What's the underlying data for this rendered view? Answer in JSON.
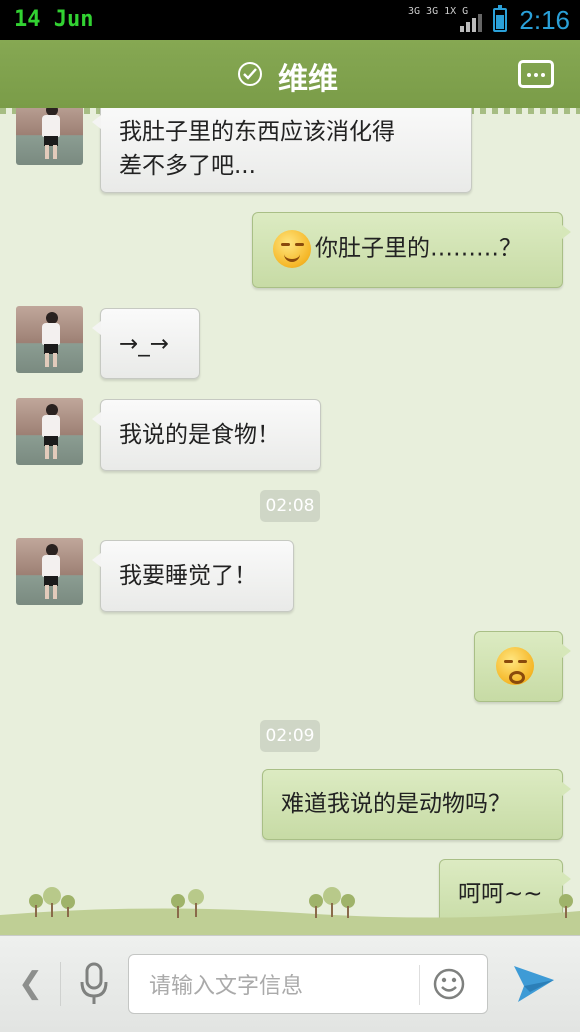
{
  "statusbar": {
    "date": "14 Jun",
    "network": "3G 3G 1X G",
    "time": "2:16"
  },
  "header": {
    "contact_name": "维维",
    "verified_icon": "check-circle-icon",
    "more_icon": "more-dots-icon"
  },
  "messages": [
    {
      "side": "in",
      "text": "我肚子里的东西应该消化得\n差不多了吧..."
    },
    {
      "side": "out",
      "emoji": "smirk-face",
      "text": "你肚子里的………？"
    },
    {
      "side": "in",
      "text": "→_→"
    },
    {
      "side": "in",
      "text": "我说的是食物！"
    },
    {
      "side": "time",
      "text": "02:08"
    },
    {
      "side": "in",
      "text": "我要睡觉了！"
    },
    {
      "side": "out",
      "emoji": "yawn-face",
      "text": ""
    },
    {
      "side": "time",
      "text": "02:09"
    },
    {
      "side": "out",
      "text": "难道我说的是动物吗？"
    },
    {
      "side": "out",
      "text": "呵呵~~"
    }
  ],
  "inputbar": {
    "placeholder": "请输入文字信息"
  },
  "colors": {
    "header": "#7fa24c",
    "chat_bg": "#e8efdc",
    "outgoing_bubble": "#d1e4b2",
    "incoming_bubble": "#f2f2f1",
    "accent_blue": "#2aa0d8"
  }
}
